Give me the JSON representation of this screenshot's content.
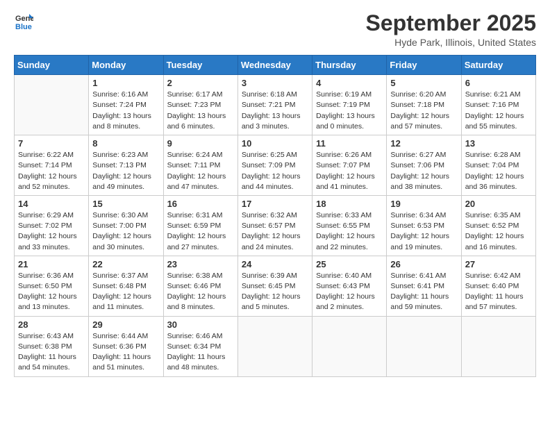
{
  "header": {
    "logo_line1": "General",
    "logo_line2": "Blue",
    "month": "September 2025",
    "location": "Hyde Park, Illinois, United States"
  },
  "weekdays": [
    "Sunday",
    "Monday",
    "Tuesday",
    "Wednesday",
    "Thursday",
    "Friday",
    "Saturday"
  ],
  "weeks": [
    [
      {
        "day": null
      },
      {
        "day": "1",
        "sunrise": "6:16 AM",
        "sunset": "7:24 PM",
        "daylight": "13 hours and 8 minutes."
      },
      {
        "day": "2",
        "sunrise": "6:17 AM",
        "sunset": "7:23 PM",
        "daylight": "13 hours and 6 minutes."
      },
      {
        "day": "3",
        "sunrise": "6:18 AM",
        "sunset": "7:21 PM",
        "daylight": "13 hours and 3 minutes."
      },
      {
        "day": "4",
        "sunrise": "6:19 AM",
        "sunset": "7:19 PM",
        "daylight": "13 hours and 0 minutes."
      },
      {
        "day": "5",
        "sunrise": "6:20 AM",
        "sunset": "7:18 PM",
        "daylight": "12 hours and 57 minutes."
      },
      {
        "day": "6",
        "sunrise": "6:21 AM",
        "sunset": "7:16 PM",
        "daylight": "12 hours and 55 minutes."
      }
    ],
    [
      {
        "day": "7",
        "sunrise": "6:22 AM",
        "sunset": "7:14 PM",
        "daylight": "12 hours and 52 minutes."
      },
      {
        "day": "8",
        "sunrise": "6:23 AM",
        "sunset": "7:13 PM",
        "daylight": "12 hours and 49 minutes."
      },
      {
        "day": "9",
        "sunrise": "6:24 AM",
        "sunset": "7:11 PM",
        "daylight": "12 hours and 47 minutes."
      },
      {
        "day": "10",
        "sunrise": "6:25 AM",
        "sunset": "7:09 PM",
        "daylight": "12 hours and 44 minutes."
      },
      {
        "day": "11",
        "sunrise": "6:26 AM",
        "sunset": "7:07 PM",
        "daylight": "12 hours and 41 minutes."
      },
      {
        "day": "12",
        "sunrise": "6:27 AM",
        "sunset": "7:06 PM",
        "daylight": "12 hours and 38 minutes."
      },
      {
        "day": "13",
        "sunrise": "6:28 AM",
        "sunset": "7:04 PM",
        "daylight": "12 hours and 36 minutes."
      }
    ],
    [
      {
        "day": "14",
        "sunrise": "6:29 AM",
        "sunset": "7:02 PM",
        "daylight": "12 hours and 33 minutes."
      },
      {
        "day": "15",
        "sunrise": "6:30 AM",
        "sunset": "7:00 PM",
        "daylight": "12 hours and 30 minutes."
      },
      {
        "day": "16",
        "sunrise": "6:31 AM",
        "sunset": "6:59 PM",
        "daylight": "12 hours and 27 minutes."
      },
      {
        "day": "17",
        "sunrise": "6:32 AM",
        "sunset": "6:57 PM",
        "daylight": "12 hours and 24 minutes."
      },
      {
        "day": "18",
        "sunrise": "6:33 AM",
        "sunset": "6:55 PM",
        "daylight": "12 hours and 22 minutes."
      },
      {
        "day": "19",
        "sunrise": "6:34 AM",
        "sunset": "6:53 PM",
        "daylight": "12 hours and 19 minutes."
      },
      {
        "day": "20",
        "sunrise": "6:35 AM",
        "sunset": "6:52 PM",
        "daylight": "12 hours and 16 minutes."
      }
    ],
    [
      {
        "day": "21",
        "sunrise": "6:36 AM",
        "sunset": "6:50 PM",
        "daylight": "12 hours and 13 minutes."
      },
      {
        "day": "22",
        "sunrise": "6:37 AM",
        "sunset": "6:48 PM",
        "daylight": "12 hours and 11 minutes."
      },
      {
        "day": "23",
        "sunrise": "6:38 AM",
        "sunset": "6:46 PM",
        "daylight": "12 hours and 8 minutes."
      },
      {
        "day": "24",
        "sunrise": "6:39 AM",
        "sunset": "6:45 PM",
        "daylight": "12 hours and 5 minutes."
      },
      {
        "day": "25",
        "sunrise": "6:40 AM",
        "sunset": "6:43 PM",
        "daylight": "12 hours and 2 minutes."
      },
      {
        "day": "26",
        "sunrise": "6:41 AM",
        "sunset": "6:41 PM",
        "daylight": "11 hours and 59 minutes."
      },
      {
        "day": "27",
        "sunrise": "6:42 AM",
        "sunset": "6:40 PM",
        "daylight": "11 hours and 57 minutes."
      }
    ],
    [
      {
        "day": "28",
        "sunrise": "6:43 AM",
        "sunset": "6:38 PM",
        "daylight": "11 hours and 54 minutes."
      },
      {
        "day": "29",
        "sunrise": "6:44 AM",
        "sunset": "6:36 PM",
        "daylight": "11 hours and 51 minutes."
      },
      {
        "day": "30",
        "sunrise": "6:46 AM",
        "sunset": "6:34 PM",
        "daylight": "11 hours and 48 minutes."
      },
      {
        "day": null
      },
      {
        "day": null
      },
      {
        "day": null
      },
      {
        "day": null
      }
    ]
  ]
}
